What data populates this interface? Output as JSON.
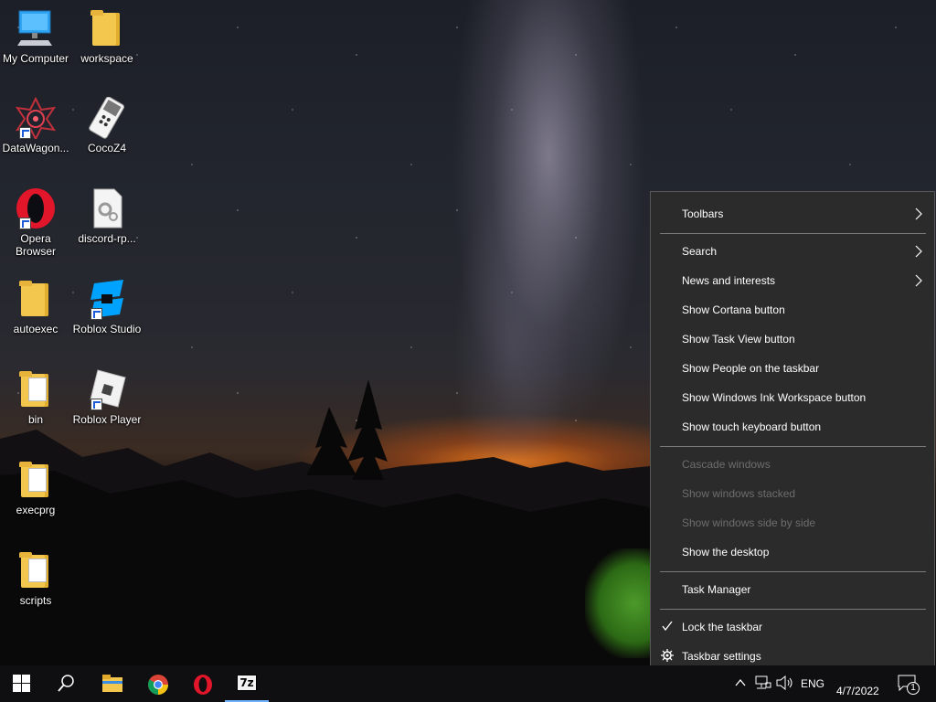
{
  "desktop": {
    "icons": [
      {
        "label": "My Computer",
        "icon": "monitor-icon"
      },
      {
        "label": "workspace",
        "icon": "folder-icon"
      },
      {
        "label": "DataWagon...",
        "icon": "datawagon-icon"
      },
      {
        "label": "CocoZ4",
        "icon": "cocoz4-icon"
      },
      {
        "label": "Opera Browser",
        "icon": "opera-icon"
      },
      {
        "label": "discord-rp...",
        "icon": "settings-file-icon"
      },
      {
        "label": "autoexec",
        "icon": "folder-icon"
      },
      {
        "label": "Roblox Studio",
        "icon": "roblox-studio-icon"
      },
      {
        "label": "bin",
        "icon": "folder-icon"
      },
      {
        "label": "Roblox Player",
        "icon": "roblox-player-icon"
      },
      {
        "label": "execprg",
        "icon": "folder-icon"
      },
      {
        "label": "scripts",
        "icon": "folder-icon"
      }
    ]
  },
  "context_menu": {
    "toolbars": "Toolbars",
    "search": "Search",
    "news": "News and interests",
    "cortana": "Show Cortana button",
    "task_view": "Show Task View button",
    "people": "Show People on the taskbar",
    "ink": "Show Windows Ink Workspace button",
    "touch_keyboard": "Show touch keyboard button",
    "cascade": "Cascade windows",
    "stacked": "Show windows stacked",
    "side_by_side": "Show windows side by side",
    "show_desktop": "Show the desktop",
    "task_manager": "Task Manager",
    "lock": "Lock the taskbar",
    "settings": "Taskbar settings"
  },
  "taskbar": {
    "apps": [
      "start-icon",
      "search-icon",
      "file-explorer-icon",
      "chrome-icon",
      "opera-icon",
      "7zip-icon"
    ],
    "seven_zip_label": "7z",
    "tray": {
      "language": "ENG",
      "date": "4/7/2022",
      "notifications_count": "1"
    }
  },
  "colors": {
    "menu_bg": "#2b2b2b",
    "menu_disabled_text": "#6d6d6d",
    "taskbar_bg": "#0f0f12",
    "active_indicator": "#6fb2ff"
  }
}
